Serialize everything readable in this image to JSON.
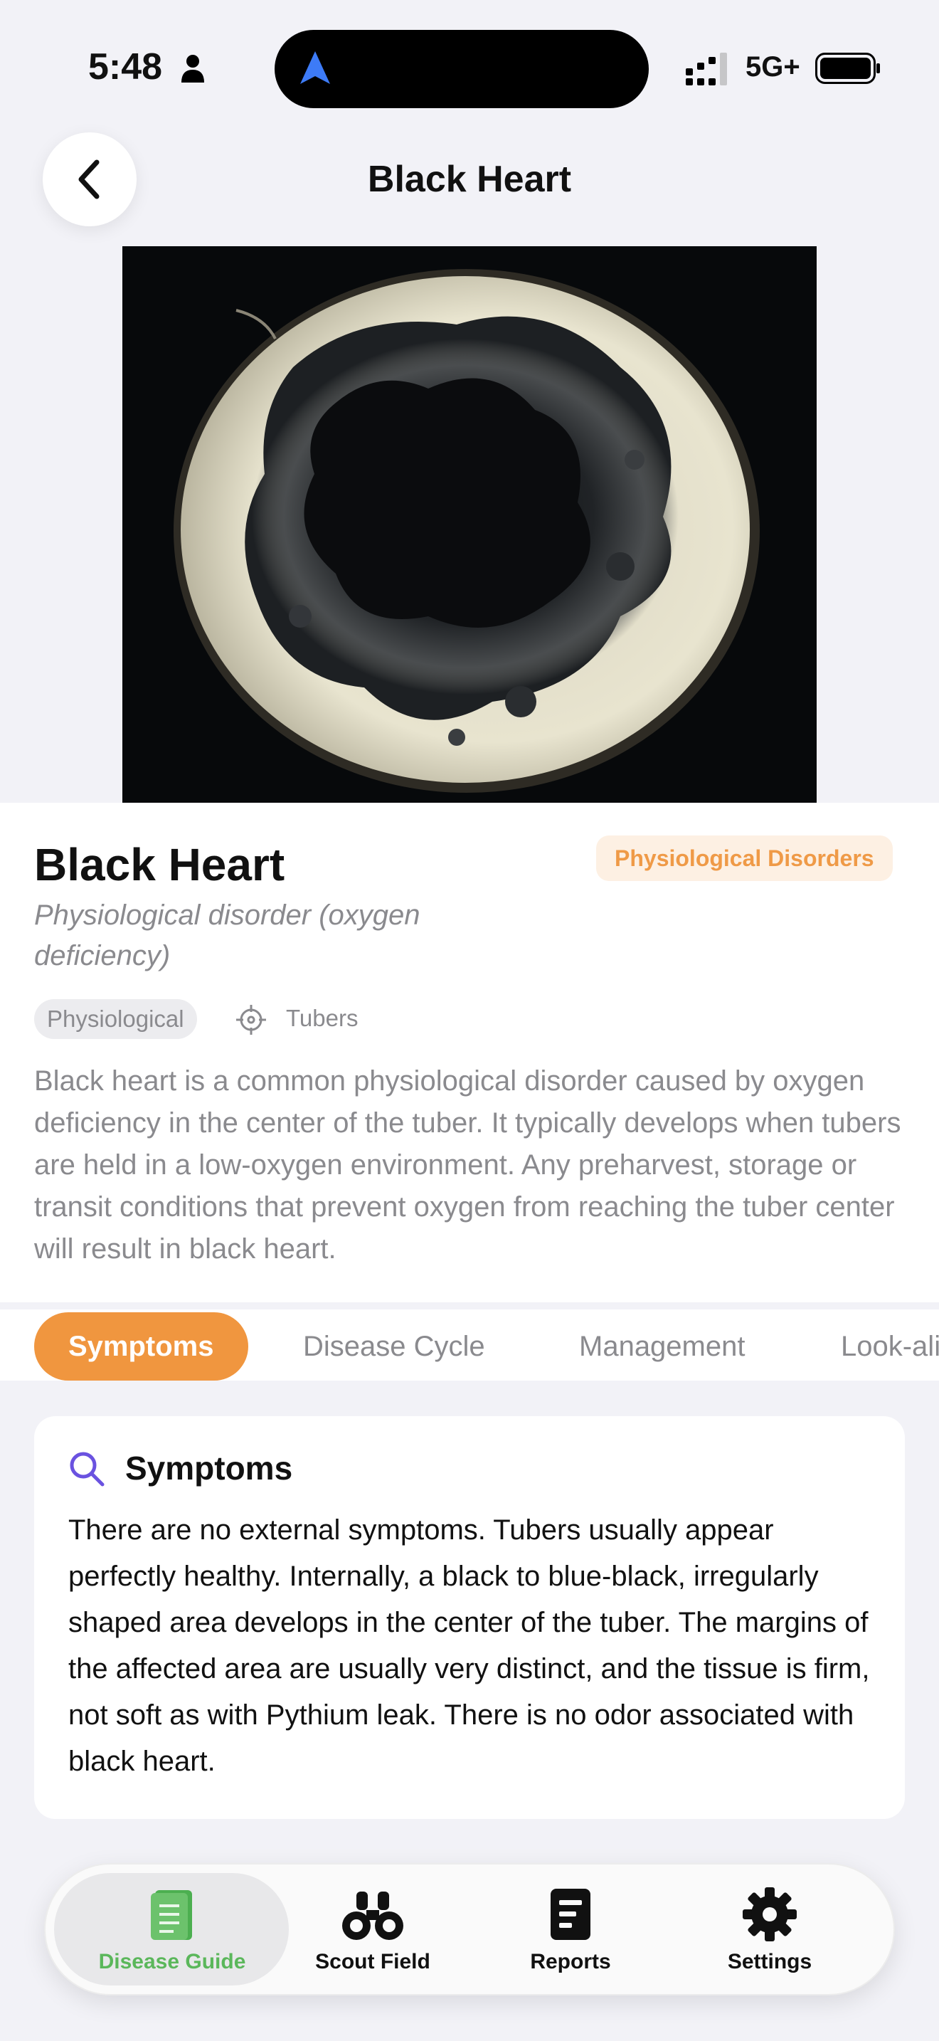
{
  "status_bar": {
    "time": "5:48",
    "network": "5G+"
  },
  "header": {
    "title": "Black Heart",
    "back_icon": "chevron-left-icon"
  },
  "disease": {
    "name": "Black Heart",
    "category": "Physiological Disorders",
    "subtitle": "Physiological disorder (oxygen deficiency)",
    "type_tag": "Physiological",
    "affected_part": "Tubers",
    "description": "Black heart is a common physiological disorder caused by oxygen deficiency in the center of the tuber. It typically develops when tubers are held in a low-oxygen environment. Any preharvest, storage or transit conditions that prevent oxygen from reaching the tuber center will result in black heart."
  },
  "tabs": [
    {
      "label": "Symptoms",
      "active": true
    },
    {
      "label": "Disease Cycle",
      "active": false
    },
    {
      "label": "Management",
      "active": false
    },
    {
      "label": "Look-alikes",
      "active": false
    }
  ],
  "symptoms": {
    "title": "Symptoms",
    "icon": "search-icon",
    "text": "There are no external symptoms. Tubers usually appear perfectly healthy. Internally, a black to blue-black, irregularly shaped area develops in the center of the tuber. The margins of the affected area are usually very distinct, and the tissue is firm, not soft as with Pythium leak. There is no odor associated with black heart."
  },
  "bottom_nav": [
    {
      "label": "Disease Guide",
      "icon": "book-icon",
      "active": true
    },
    {
      "label": "Scout Field",
      "icon": "binoculars-icon",
      "active": false
    },
    {
      "label": "Reports",
      "icon": "document-icon",
      "active": false
    },
    {
      "label": "Settings",
      "icon": "gear-icon",
      "active": false
    }
  ],
  "colors": {
    "accent": "#f0963f",
    "badge_bg": "#fdf0e3",
    "nav_active": "#5bb75b",
    "search_icon": "#6a52e0"
  }
}
